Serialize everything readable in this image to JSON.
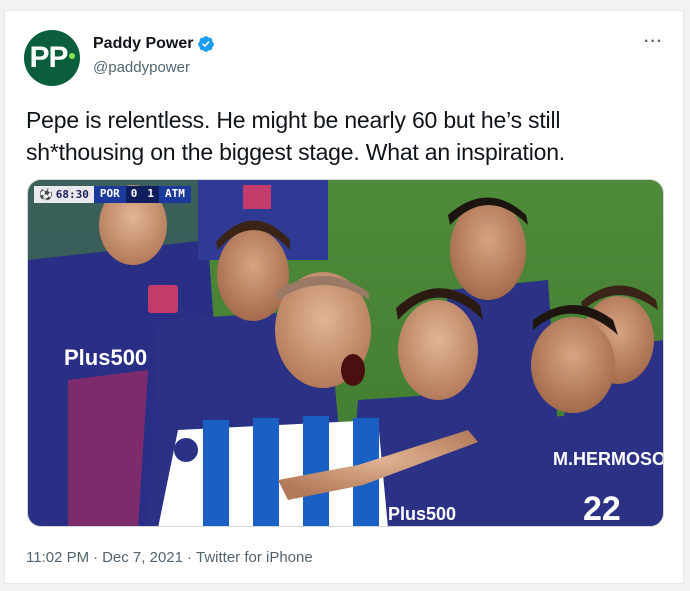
{
  "author": {
    "display_name": "Paddy Power",
    "handle": "@paddypower",
    "avatar_text": "PP",
    "verified": true
  },
  "tweet": {
    "text": "Pepe is relentless. He might be nearly 60 but he’s still sh*thousing on the biggest stage. What an inspiration."
  },
  "media": {
    "description_icon": "photo",
    "scoreboard": {
      "clock": "68:30",
      "home": "POR",
      "home_score": "0",
      "away_score": "1",
      "away": "ATM"
    },
    "shirt_texts": [
      "Plus500",
      "Plus500",
      "M.HERMOSO",
      "22"
    ]
  },
  "meta": {
    "time": "11:02 PM",
    "separator": "·",
    "date": "Dec 7, 2021",
    "source": "Twitter for iPhone"
  },
  "colors": {
    "verified_blue": "#1d9bf0",
    "avatar_green": "#0b5e3c",
    "secondary_text": "#536471"
  }
}
